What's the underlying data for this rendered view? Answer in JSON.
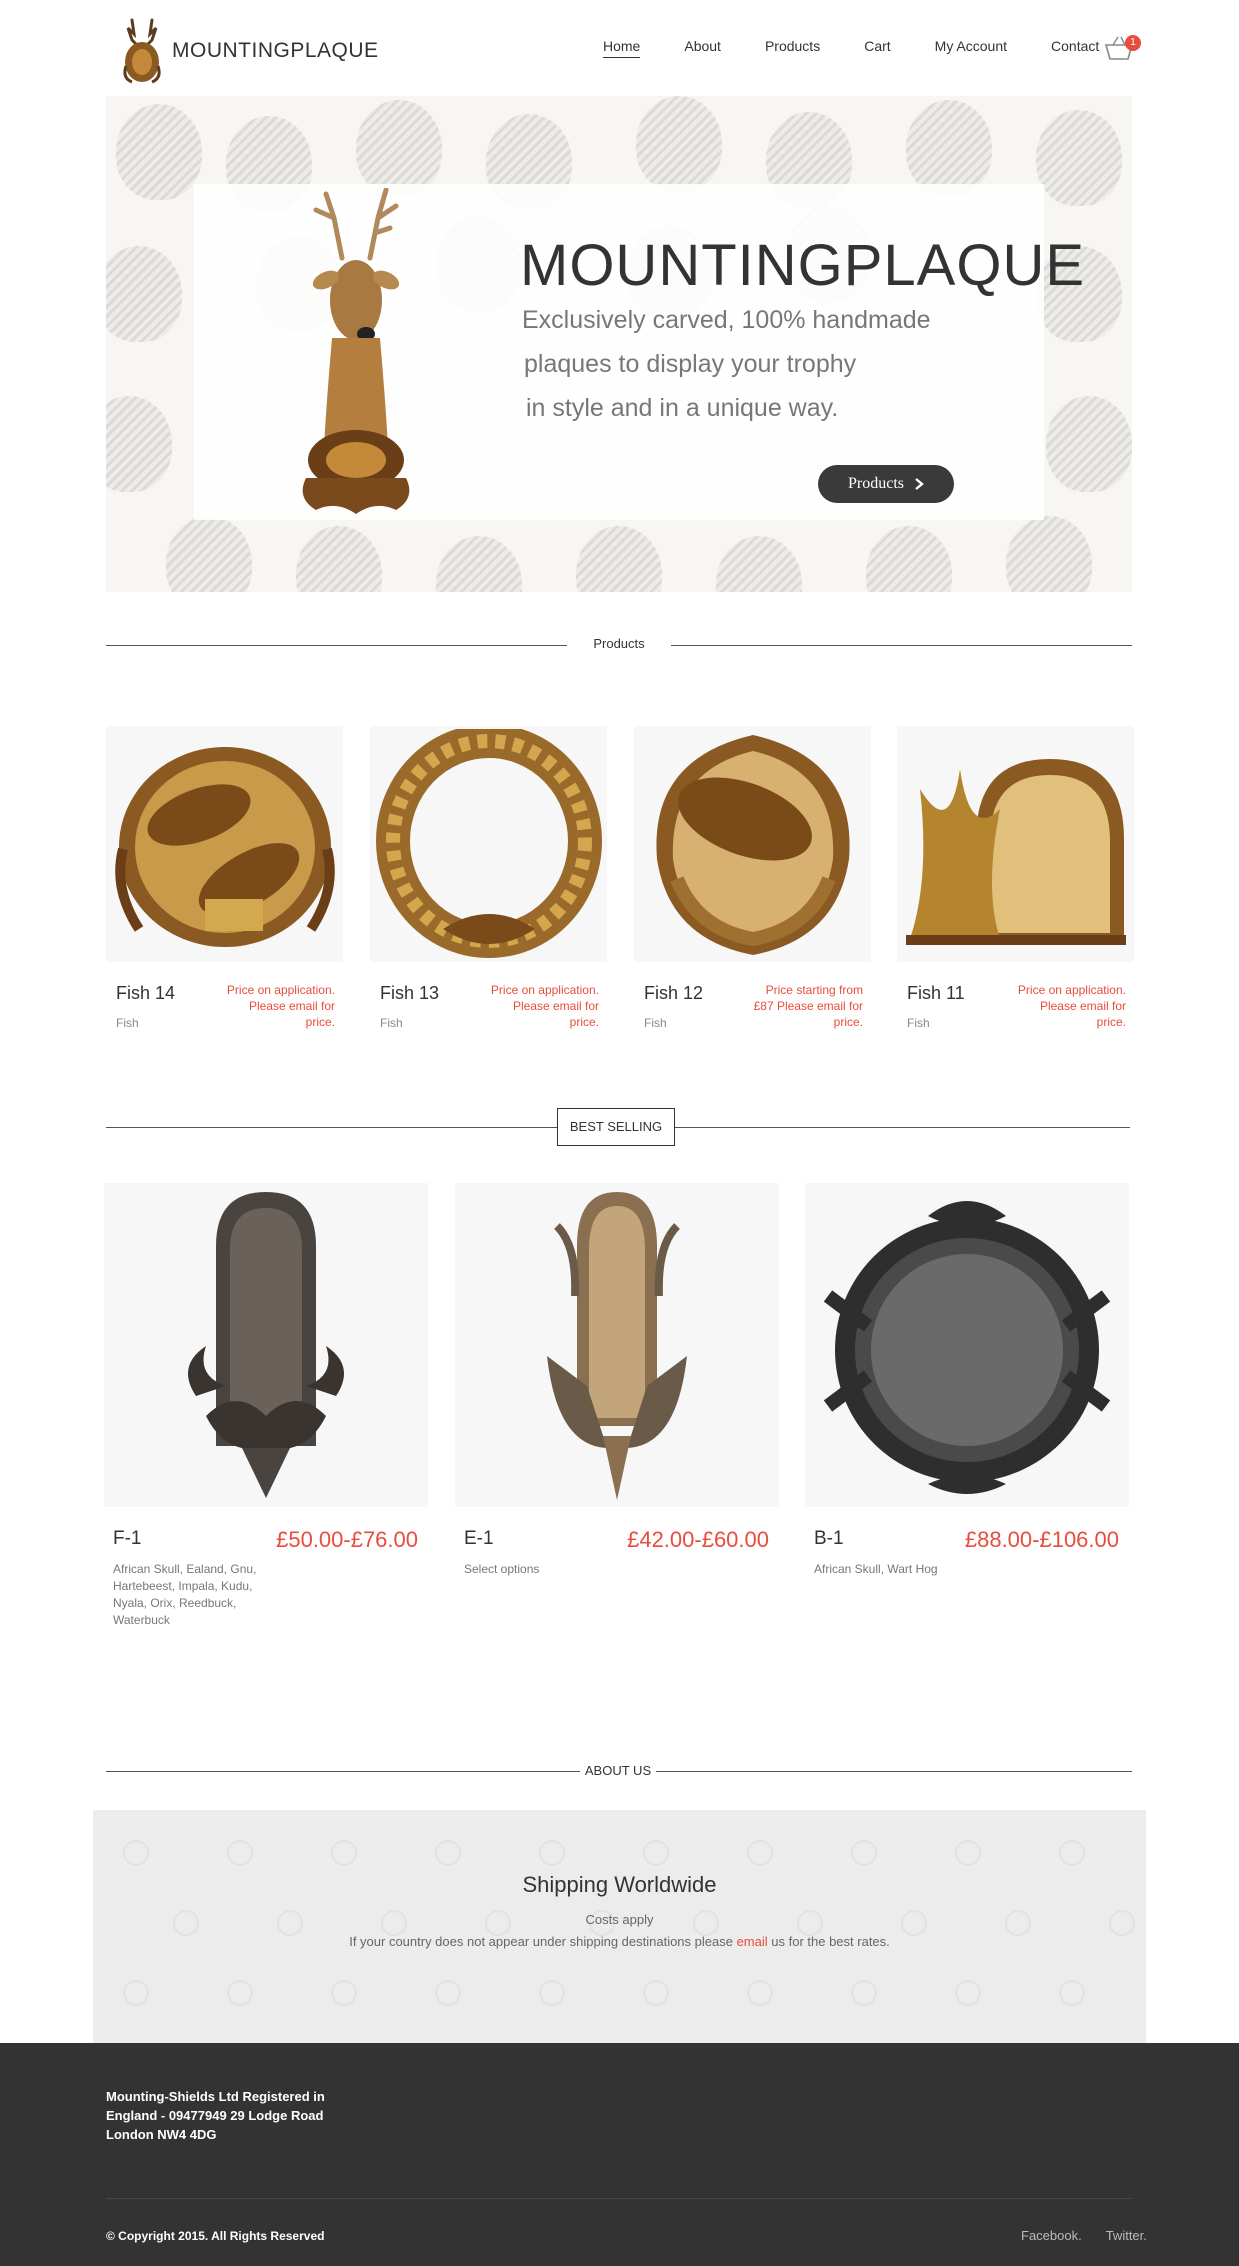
{
  "brand": {
    "name": "MOUNTINGPLAQUE"
  },
  "nav": {
    "items": [
      {
        "label": "Home",
        "active": true
      },
      {
        "label": "About"
      },
      {
        "label": "Products"
      },
      {
        "label": "Cart"
      },
      {
        "label": "My Account"
      },
      {
        "label": "Contact"
      }
    ]
  },
  "cart": {
    "count": "1",
    "icon": "basket-icon"
  },
  "hero": {
    "title": "MOUNTINGPLAQUE",
    "lines": [
      "Exclusively carved, 100% handmade",
      "plaques to display your trophy",
      "in style and in a unique way."
    ],
    "button_label": "Products"
  },
  "products_section": {
    "label": "Products",
    "items": [
      {
        "name": "Fish 14",
        "category": "Fish",
        "price": "Price on application. Please email for price."
      },
      {
        "name": "Fish 13",
        "category": "Fish",
        "price": "Price on application. Please email for price."
      },
      {
        "name": "Fish 12",
        "category": "Fish",
        "price": "Price starting from £87 Please email for price."
      },
      {
        "name": "Fish 11",
        "category": "Fish",
        "price": "Price on application. Please email for price."
      }
    ]
  },
  "best_selling": {
    "label": "BEST SELLING",
    "items": [
      {
        "name": "F-1",
        "price": "£50.00-£76.00",
        "desc": "African Skull, Ealand, Gnu, Hartebeest, Impala, Kudu, Nyala, Orix, Reedbuck, Waterbuck"
      },
      {
        "name": "E-1",
        "price": "£42.00-£60.00",
        "desc": "Select options"
      },
      {
        "name": "B-1",
        "price": "£88.00-£106.00",
        "desc": "African Skull, Wart Hog"
      }
    ]
  },
  "about": {
    "label": "ABOUT US",
    "title": "Shipping Worldwide",
    "subtitle": "Costs apply",
    "text_before": "If your country does not appear under shipping destinations please ",
    "link": "email",
    "text_after": " us for the best rates."
  },
  "footer": {
    "address": "Mounting-Shields Ltd Registered in England - 09477949 29 Lodge Road London NW4 4DG",
    "copyright": "© Copyright 2015. All Rights Reserved",
    "social": [
      "Facebook.",
      "Twitter."
    ]
  },
  "colors": {
    "accent": "#e74c3c",
    "dark": "#333333",
    "button": "#3a3a3a"
  }
}
